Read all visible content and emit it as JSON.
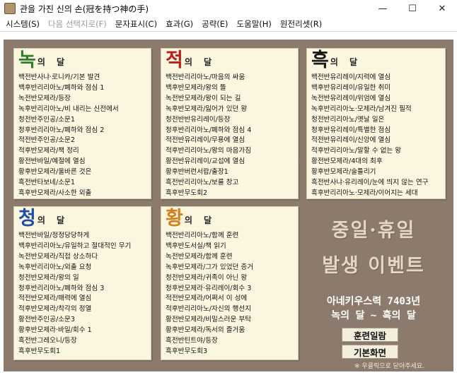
{
  "window": {
    "title": "관을 가진 신의 손(冠を持つ神の手)",
    "minimize": "—",
    "maximize": "☐",
    "close": "✕"
  },
  "menu": [
    {
      "label": "시스템(S)",
      "enabled": true
    },
    {
      "label": "다음 선택지로(F)",
      "enabled": false
    },
    {
      "label": "문자표시(C)",
      "enabled": true
    },
    {
      "label": "효과(G)",
      "enabled": true
    },
    {
      "label": "공략(E)",
      "enabled": true
    },
    {
      "label": "도움말(H)",
      "enabled": true
    },
    {
      "label": "원전리셋(R)",
      "enabled": true
    }
  ],
  "panels": {
    "green": {
      "char": "녹",
      "sub": "의 달",
      "color": "#2f7d2a",
      "items": [
        "백전반사냐·로니카/기본 발견",
        "백후반리리아노/폐하와 점심 1",
        "녹전반모제라/등장",
        "녹후반리리아노/비 내리는 신전에서",
        "청전반주인공/소문1",
        "청후반리리아노/폐하와 점심 2",
        "적전반주인공/소문2",
        "적후반모제라/책 정리",
        "황전반바일/예절에 열심",
        "황후반모제라/울바른 것은",
        "흑전반타보네/소문1",
        "흑후반모제라/사소한 외출"
      ]
    },
    "red": {
      "char": "적",
      "sub": "의 달",
      "color": "#b8221c",
      "items": [
        "백전반리리아노/마음의 싸움",
        "백후반모제라/왕의 뜰",
        "녹전반모제라/왕이 되는 길",
        "녹후반모제라/잃어가 있던 왕",
        "청전반반유리레이/등장",
        "청후반리리아노/폐하와 점심 4",
        "적전반유리레이/무용에 열심",
        "적후반리리아노/왕의 마음가짐",
        "황전반유리레이/교섭에 열심",
        "황후반버런서랍/출장1",
        "흑전반리리아노/보를 창고",
        "흑후반무도회2"
      ]
    },
    "black": {
      "char": "흑",
      "sub": "의 달",
      "color": "#1a1a1a",
      "items": [
        "백전반유리레이/지력에 열심",
        "백후반유리레이/유일한 취미",
        "녹전반유리레이/위엄에 열심",
        "녹후반리리아노·모제라/남겨진 필적",
        "청전반리리아노/옛날 일은",
        "청후반유리레이/특별한 점심",
        "적전반유리레이/신앙에 열심",
        "적후반리리아노/말할 수 없는 왕",
        "황전반모제라/4대의 최후",
        "황후반모제라/술틀리기",
        "흑전반사냐·유리레이/눈에 띄지 않는 연구",
        "흑후반리리아노·모제라/이어지는 세대"
      ]
    },
    "blue": {
      "char": "청",
      "sub": "의 달",
      "color": "#1d4fa0",
      "items": [
        "백전반바일/정정당당하게",
        "백후반리리아노/유일하고 절대적인 무기",
        "녹전반모제라/직접 상소하다",
        "녹후반리리아노/외출 요청",
        "청전반모제라/왕의 일",
        "청후반리리아노/폐하와 점심 3",
        "적전반모제라/매력에 열심",
        "적후반모제라/착각의 정열",
        "황전반주인공/소문3",
        "황후반모제라·바일/회수 1",
        "흑전반그레오니/등장",
        "흑후반무도회1"
      ]
    },
    "yellow": {
      "char": "황",
      "sub": "의 달",
      "color": "#d2811e",
      "items": [
        "백전반리리아노/함께 훈련",
        "백후반도서실/책 읽기",
        "녹전반모제라/함께 훈련",
        "녹후반모제라/그가 있었던 증거",
        "청전반모제라/귀족이 아닌 왕",
        "청후반모제라·유리레이/회수 3",
        "적전반모제라/어쩌서 이 성에",
        "적후반리리아노/자신의 행선지",
        "황전반모제라/비밀스러운 부탁",
        "황후반모제라/독서의 즐거움",
        "흑전반틴트야/등장",
        "흑후반무도회3"
      ]
    }
  },
  "promo": {
    "line1": "중일·휴일",
    "line2": "발생 이벤트",
    "anniv1": "아네키우스력 7403년",
    "anniv2": "녹의 달 ~ 흑의 달"
  },
  "buttons": {
    "training": "훈련일람",
    "main": "기본화면"
  },
  "note": "※ 우클릭으로 닫아주세요."
}
